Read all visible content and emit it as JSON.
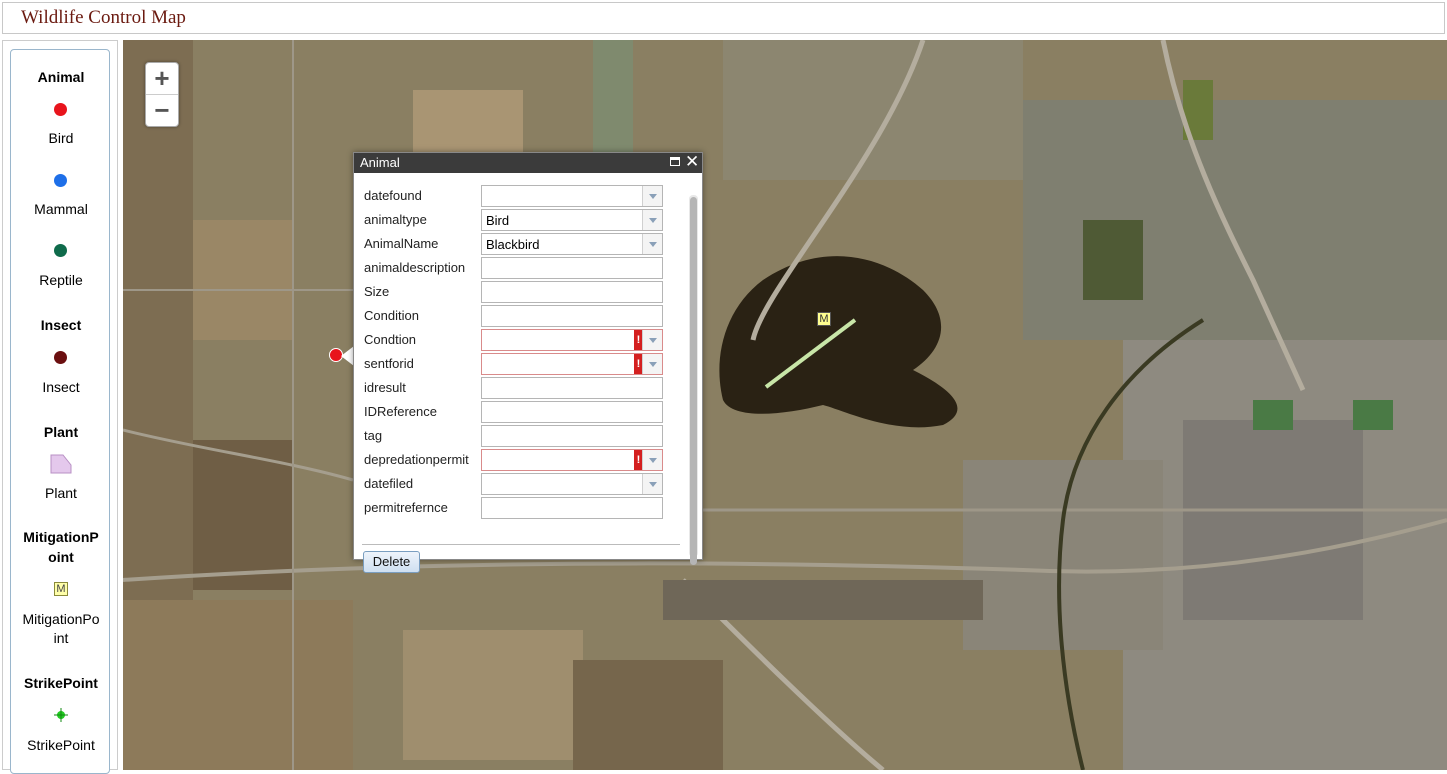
{
  "app": {
    "title": "Wildlife Control Map"
  },
  "legend": {
    "groups": [
      {
        "heading": "Animal",
        "items": [
          {
            "label": "Bird",
            "color": "#e8141c"
          },
          {
            "label": "Mammal",
            "color": "#1e6fe8"
          },
          {
            "label": "Reptile",
            "color": "#0f6b4b"
          }
        ]
      },
      {
        "heading": "Insect",
        "items": [
          {
            "label": "Insect",
            "color": "#6b0f10"
          }
        ]
      },
      {
        "heading": "Plant",
        "items": [
          {
            "label": "Plant",
            "color": "#e4c8ec"
          }
        ]
      },
      {
        "heading": "MitigationPoint",
        "heading_line1": "MitigationP",
        "heading_line2": "oint",
        "items": [
          {
            "label_line1": "MitigationPo",
            "label_line2": "int",
            "symbol_text": "M"
          }
        ]
      },
      {
        "heading": "StrikePoint",
        "items": [
          {
            "label": "StrikePoint",
            "color": "#22cc22"
          }
        ]
      }
    ]
  },
  "map": {
    "zoom_in": "+",
    "zoom_out": "−",
    "mitigation_marker_text": "M"
  },
  "popup": {
    "title": "Animal",
    "fields": [
      {
        "label": "datefound",
        "value": "",
        "type": "select",
        "error": false
      },
      {
        "label": "animaltype",
        "value": "Bird",
        "type": "select",
        "error": false
      },
      {
        "label": "AnimalName",
        "value": "Blackbird",
        "type": "select",
        "error": false
      },
      {
        "label": "animaldescription",
        "value": "",
        "type": "text",
        "error": false
      },
      {
        "label": "Size",
        "value": "",
        "type": "text",
        "error": false
      },
      {
        "label": "Condition",
        "value": "",
        "type": "text",
        "error": false
      },
      {
        "label": "Condtion",
        "value": "",
        "type": "select",
        "error": true
      },
      {
        "label": "sentforid",
        "value": "",
        "type": "select",
        "error": true
      },
      {
        "label": "idresult",
        "value": "",
        "type": "text",
        "error": false
      },
      {
        "label": "IDReference",
        "value": "",
        "type": "text",
        "error": false
      },
      {
        "label": "tag",
        "value": "",
        "type": "text",
        "error": false
      },
      {
        "label": "depredationpermit",
        "value": "",
        "type": "select",
        "error": true
      },
      {
        "label": "datefiled",
        "value": "",
        "type": "select",
        "error": false
      },
      {
        "label": "permitrefernce",
        "value": "",
        "type": "text",
        "error": false
      }
    ],
    "error_glyph": "!",
    "delete_label": "Delete"
  }
}
